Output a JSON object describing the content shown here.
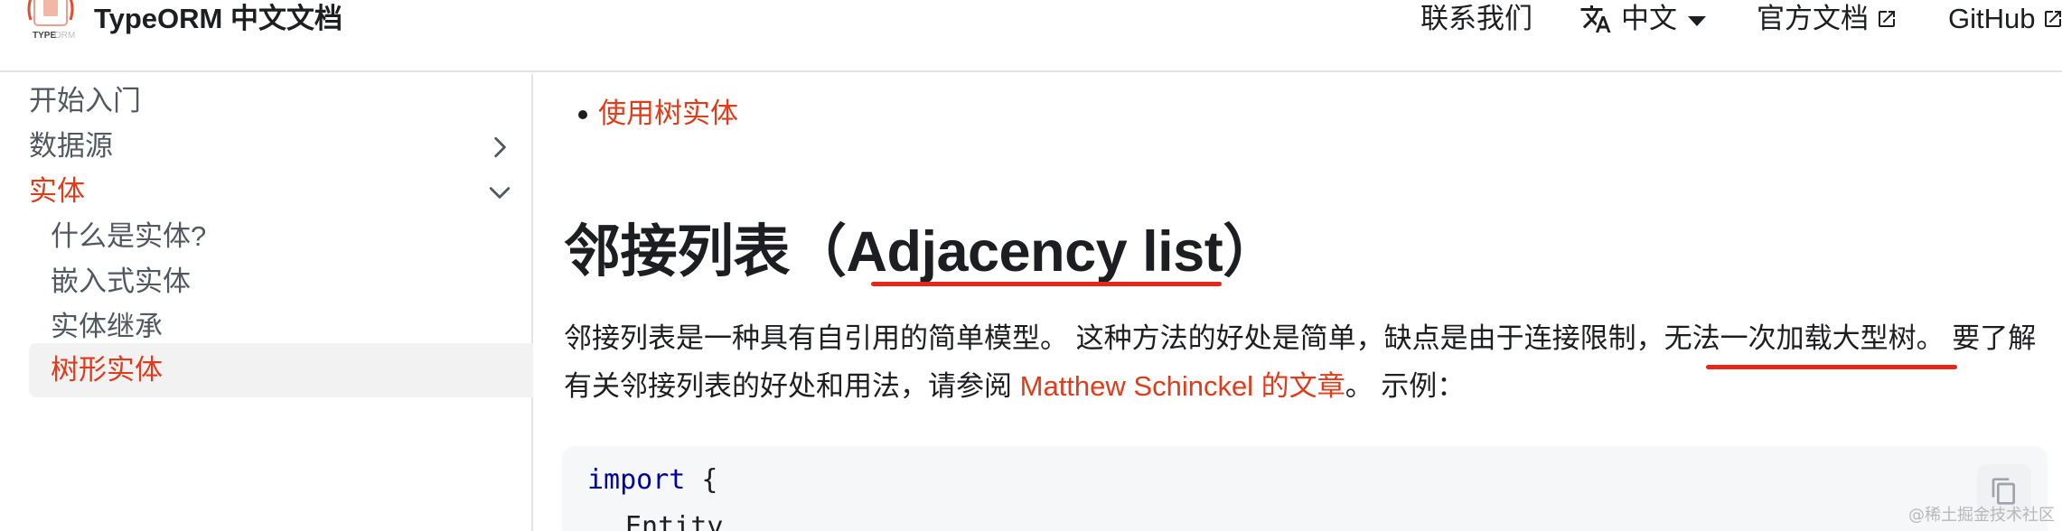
{
  "navbar": {
    "brand": "TypeORM 中文文档",
    "contact": "联系我们",
    "language": "中文",
    "docs": "官方文档",
    "github": "GitHub"
  },
  "sidebar": {
    "items": [
      {
        "label": "开始入门"
      },
      {
        "label": "数据源"
      },
      {
        "label": "实体"
      }
    ],
    "subitems": [
      {
        "label": "什么是实体?"
      },
      {
        "label": "嵌入式实体"
      },
      {
        "label": "实体继承"
      },
      {
        "label": "树形实体"
      }
    ]
  },
  "content": {
    "bullet_link": "使用树实体",
    "heading": "邻接列表（Adjacency list）",
    "para_part1": "邻接列表是一种具有自引用的简单模型。 这种方法的好处是简单，缺点是由于连接限制，",
    "para_highlight": "无法一次加载大型树",
    "para_part2": "。 要了解有关邻接列表的好处和用法，请参阅 ",
    "para_link": "Matthew Schinckel 的文章",
    "para_part3": "。 示例：",
    "code_keyword": "import",
    "code_brace": " {",
    "code_line2": "Entity,"
  },
  "watermark": "@稀土掘金技术社区",
  "colors": {
    "accent": "#e03b1a",
    "annotation": "#e6281a",
    "code_keyword": "#00009f"
  }
}
